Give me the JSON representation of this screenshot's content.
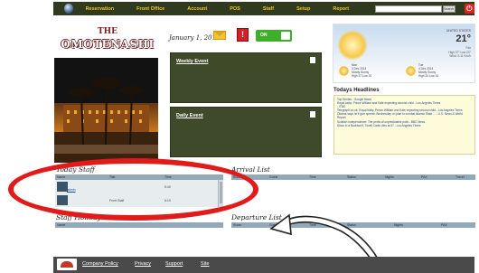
{
  "nav": {
    "items": [
      "Reservation",
      "Front Office",
      "Account",
      "POS",
      "Staff",
      "Setup",
      "Report"
    ],
    "search_label": "Search",
    "power_glyph": "⏻"
  },
  "brand": {
    "the": "THE",
    "name": "OMOTENASHI"
  },
  "header": {
    "date": "January 1, 2015",
    "alert": "!",
    "toggle_label": "ON"
  },
  "events": {
    "weekly": "Weekly Event",
    "daily": "Daily Event"
  },
  "weather": {
    "location": "UNITED STATES",
    "temp": "21°",
    "conditions": [
      "Fair",
      "High 37° Low 20°",
      "Wind: S 11 Km/h"
    ],
    "forecast": [
      {
        "day": "Mon",
        "date": "3 Dec 2014",
        "cond": "Mostly Sunny",
        "hl": "High 37 Low 20"
      },
      {
        "day": "Tue",
        "date": "4 Dec 2014",
        "cond": "Mostly Sunny",
        "hl": "High 34 Low 24"
      }
    ]
  },
  "headlines": {
    "title": "Todays Headlines",
    "items": [
      "Top Stories - Google News",
      "Royal baby: Prince William and Kate expecting second child - Los Angeles Times",
      "- ITBS",
      "Telegraph.co.uk: Royal baby: Prince William and Kate expecting second child - Los Angeles Times",
      "Obama says he'll give speech Wednesday on plan to combat Islamic State ... - U.S. News & World Report",
      "Scottish independence: The perils of unpredictable polls - BBC News",
      "Disco in a Navidad fl, Toxell Carlin dies at 67 - Los Angeles Times"
    ]
  },
  "today_staff": {
    "title": "Today Staff",
    "columns": [
      "Name",
      "Title",
      "Time"
    ],
    "rows": [
      {
        "name": "admin",
        "title": "",
        "time": "5:40"
      },
      {
        "name": "",
        "title": "Front Staff",
        "time": "6:19"
      }
    ]
  },
  "arrival": {
    "title": "Arrival List",
    "columns": [
      "Room",
      "Guest",
      "Time",
      "Status",
      "Nights",
      "PAX",
      "Travel"
    ]
  },
  "staff_holiday": {
    "title": "Staff Holiday",
    "columns": [
      "Name"
    ]
  },
  "departure": {
    "title": "Departure List",
    "columns": [
      "Room",
      "Guest",
      "Time",
      "Status",
      "Nights",
      "PAX"
    ]
  },
  "footer": {
    "links": [
      "Company Policy",
      "Privacy",
      "Support",
      "Site"
    ]
  }
}
